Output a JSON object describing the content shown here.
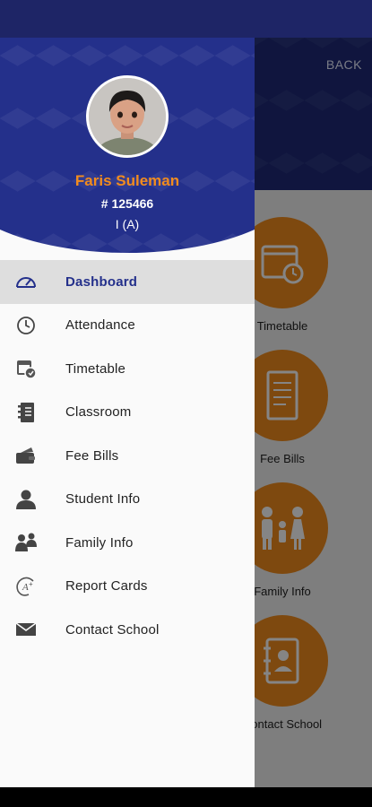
{
  "colors": {
    "primary": "#24308b",
    "accent": "#f28c1e",
    "active_bg": "#dedede"
  },
  "background": {
    "back_label": "BACK",
    "tiles": [
      {
        "label": "Timetable",
        "icon": "calendar-clock-icon"
      },
      {
        "label": "Fee Bills",
        "icon": "receipt-icon"
      },
      {
        "label": "Family Info",
        "icon": "family-icon"
      },
      {
        "label": "Contact School",
        "icon": "contact-book-icon"
      }
    ]
  },
  "profile": {
    "name": "Faris Suleman",
    "reg_no": "# 125466",
    "class": "I (A)"
  },
  "menu": {
    "items": [
      {
        "label": "Dashboard",
        "icon": "dashboard-gauge-icon",
        "active": true
      },
      {
        "label": "Attendance",
        "icon": "clock-icon",
        "active": false
      },
      {
        "label": "Timetable",
        "icon": "calendar-icon",
        "active": false
      },
      {
        "label": "Classroom",
        "icon": "notebook-icon",
        "active": false
      },
      {
        "label": "Fee Bills",
        "icon": "wallet-icon",
        "active": false
      },
      {
        "label": "Student Info",
        "icon": "person-icon",
        "active": false
      },
      {
        "label": "Family Info",
        "icon": "family-icon",
        "active": false
      },
      {
        "label": "Report Cards",
        "icon": "grade-icon",
        "active": false
      },
      {
        "label": "Contact School",
        "icon": "mail-icon",
        "active": false
      }
    ]
  }
}
